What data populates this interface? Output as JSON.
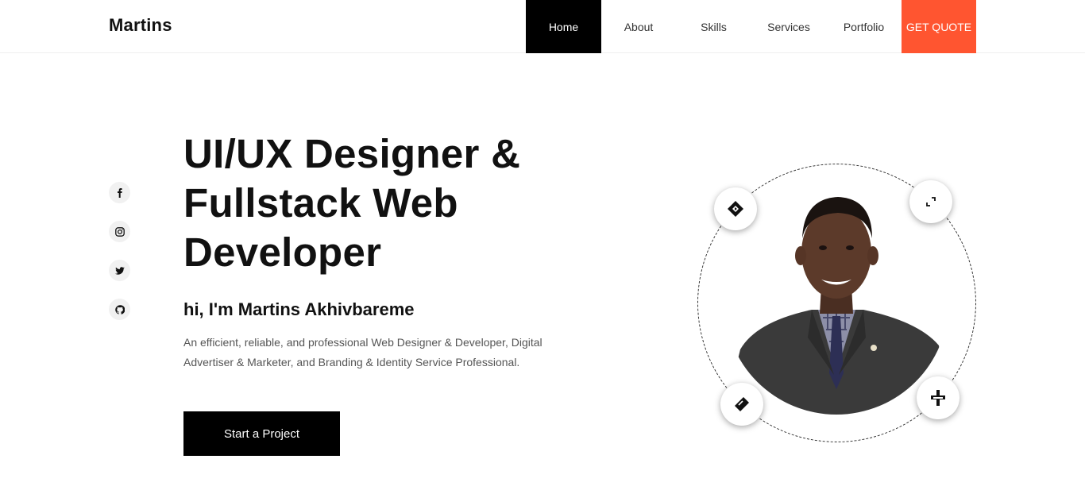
{
  "brand": "Martins",
  "nav": {
    "items": [
      {
        "label": "Home"
      },
      {
        "label": "About"
      },
      {
        "label": "Skills"
      },
      {
        "label": "Services"
      },
      {
        "label": "Portfolio"
      }
    ],
    "quote_label": "GET QUOTE"
  },
  "social": [
    "facebook-icon",
    "instagram-icon",
    "twitter-icon",
    "github-icon"
  ],
  "hero": {
    "title_line1": "UI/UX Designer &",
    "title_line2": "Fullstack Web",
    "title_line3": "Developer",
    "subtitle": "hi, I'm Martins Akhivbareme",
    "description": "An efficient, reliable, and professional Web Designer & Developer, Digital Advertiser & Marketer, and Branding & Identity Service Professional.",
    "cta_label": "Start a Project"
  },
  "orbit_icons": [
    "design-tool-icon",
    "expand-icon",
    "ruler-icon",
    "pen-tool-icon"
  ],
  "colors": {
    "accent": "#ff5530",
    "active_nav": "#000000",
    "text": "#111111",
    "muted": "#555555"
  }
}
